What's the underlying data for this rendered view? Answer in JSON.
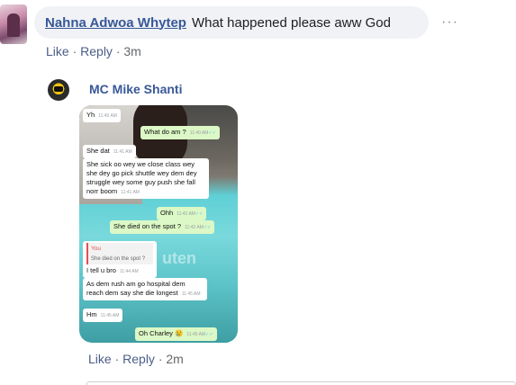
{
  "comment1": {
    "author": "Nahna Adwoa Whytep",
    "text": "What happened please aww God",
    "more_label": "···",
    "actions": {
      "like": "Like",
      "reply": "Reply",
      "sep": " · ",
      "time": "3m"
    }
  },
  "reply1": {
    "author": "MC Mike Shanti",
    "actions": {
      "like": "Like",
      "reply": "Reply",
      "sep": " · ",
      "time": "2m"
    },
    "image": {
      "brand_text": "uten",
      "messages": [
        {
          "side": "in",
          "text": "Yh",
          "time": "11:40 AM"
        },
        {
          "side": "out",
          "text": "What do am ?",
          "time": "11:40 AM"
        },
        {
          "side": "in",
          "text": "She dat",
          "time": "11:41 AM"
        },
        {
          "side": "in",
          "text": "She sick oo wey we close class wey she dey go pick shuttle wey dem dey struggle wey some guy push she fall norr boom",
          "time": "11:41 AM"
        },
        {
          "side": "out",
          "text": "Ohh",
          "time": "11:42 AM"
        },
        {
          "side": "out",
          "text": "She died on the spot ?",
          "time": "11:42 AM"
        },
        {
          "side": "in",
          "quote_author": "You",
          "quote_text": "She died on the spot ?",
          "text": "I tell u bro",
          "time": "11:44 AM"
        },
        {
          "side": "in",
          "text": "As dem rush am go hospital dem reach dem say she die longest",
          "time": "11:45 AM"
        },
        {
          "side": "in",
          "text": "Hm",
          "time": "11:45 AM"
        },
        {
          "side": "out",
          "text": "Oh Charley 😢",
          "time": "11:45 AM"
        }
      ]
    }
  }
}
